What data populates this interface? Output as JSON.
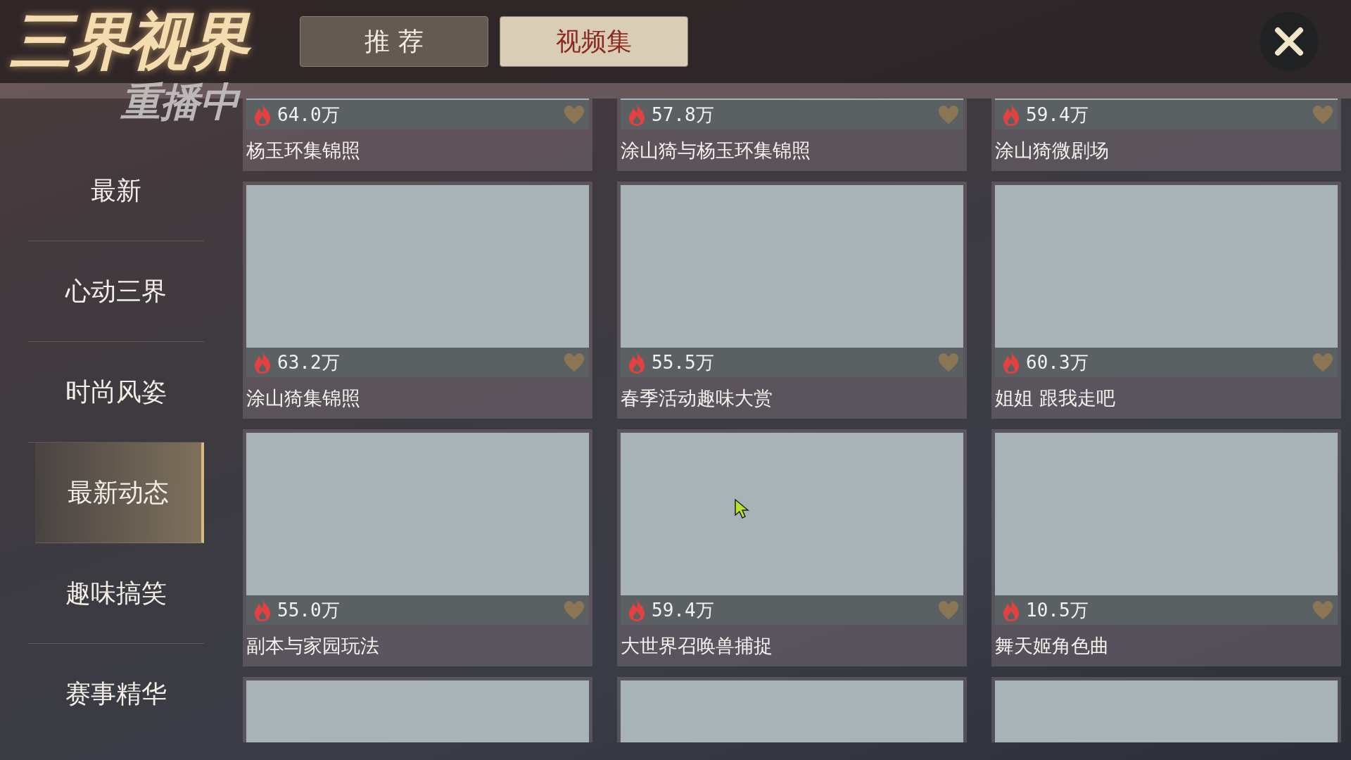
{
  "logo": {
    "title": "三界视界"
  },
  "tabs": [
    {
      "label": "推 荐",
      "selected": false
    },
    {
      "label": "视频集",
      "selected": true
    }
  ],
  "replay_banner": "重播中",
  "sidebar": {
    "items": [
      {
        "label": "最新",
        "selected": false
      },
      {
        "label": "心动三界",
        "selected": false
      },
      {
        "label": "时尚风姿",
        "selected": false
      },
      {
        "label": "最新动态",
        "selected": true
      },
      {
        "label": "趣味搞笑",
        "selected": false
      },
      {
        "label": "赛事精华",
        "selected": false
      }
    ]
  },
  "videos": [
    {
      "kind": "full",
      "count": "64.0万",
      "title": "杨玉环集锦照"
    },
    {
      "kind": "full",
      "count": "57.8万",
      "title": "涂山猗与杨玉环集锦照"
    },
    {
      "kind": "full",
      "count": "59.4万",
      "title": "涂山猗微剧场"
    },
    {
      "kind": "full",
      "count": "63.2万",
      "title": "涂山猗集锦照"
    },
    {
      "kind": "full",
      "count": "55.5万",
      "title": "春季活动趣味大赏"
    },
    {
      "kind": "full",
      "count": "60.3万",
      "title": "姐姐 跟我走吧"
    },
    {
      "kind": "full",
      "count": "55.0万",
      "title": "副本与家园玩法"
    },
    {
      "kind": "full",
      "count": "59.4万",
      "title": "大世界召唤兽捕捉"
    },
    {
      "kind": "full",
      "count": "10.5万",
      "title": "舞天姬角色曲"
    },
    {
      "kind": "thumbnail_only"
    },
    {
      "kind": "thumbnail_only"
    },
    {
      "kind": "thumbnail_only"
    }
  ]
}
